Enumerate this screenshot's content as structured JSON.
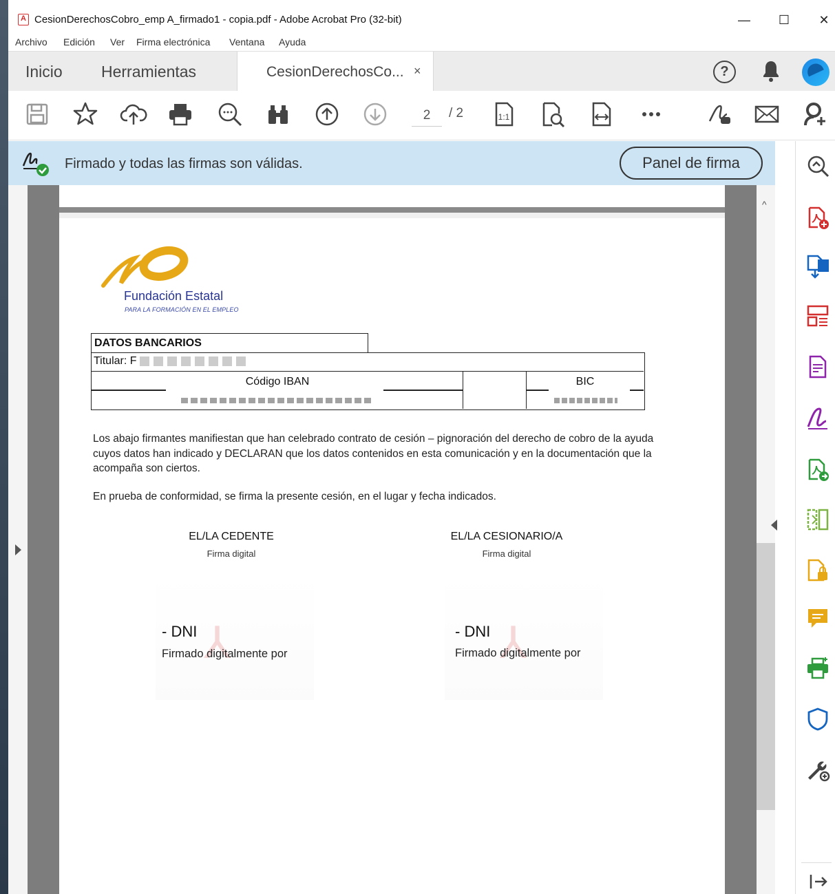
{
  "window": {
    "title": "CesionDerechosCobro_emp A_firmado1 - copia.pdf - Adobe Acrobat Pro (32-bit)",
    "minimize_glyph": "—",
    "maximize_glyph": "☐",
    "close_glyph": "✕"
  },
  "menu": [
    "Archivo",
    "Edición",
    "Ver",
    "Firma electrónica",
    "Ventana",
    "Ayuda"
  ],
  "tabs": {
    "home": "Inicio",
    "tools": "Herramientas",
    "document": "CesionDerechosCo...",
    "close_glyph": "×"
  },
  "toolbar": {
    "page_current": "2",
    "page_total": "/ 2",
    "icons": [
      "save-icon",
      "star-icon",
      "cloud-upload-icon",
      "print-icon",
      "zoom-search-icon",
      "find-binoculars-icon",
      "page-up-icon",
      "page-down-icon",
      "fit-page-icon",
      "document-search-icon",
      "fit-width-icon",
      "more-icon",
      "sign-link-icon",
      "mail-icon",
      "add-user-icon"
    ]
  },
  "signbar": {
    "message": "Firmado y todas las firmas son válidas.",
    "panel_button": "Panel de firma"
  },
  "document": {
    "logo_name": "Fundación Estatal",
    "logo_subtitle": "PARA LA FORMACIÓN EN EL EMPLEO",
    "bank_heading": "DATOS BANCARIOS",
    "titular_label": "Titular: F",
    "iban_label": "Código IBAN",
    "bic_label": "BIC",
    "paragraph1": "Los abajo firmantes manifiestan que han celebrado contrato de cesión – pignoración del derecho de cobro de la ayuda cuyos datos han indicado y DECLARAN que los datos contenidos en esta comunicación y en la documentación que la acompaña son ciertos.",
    "paragraph2": "En prueba de conformidad, se firma la presente cesión, en el lugar y fecha indicados.",
    "cedente_title": "EL/LA CEDENTE",
    "cesionario_title": "EL/LA CESIONARIO/A",
    "digital_signature": "Firma digital",
    "dni_label": "- DNI",
    "signed_by": "Firmado digitalmente por"
  },
  "right_tools": [
    "create-pdf-icon",
    "export-pdf-icon",
    "organize-pages-icon",
    "edit-pdf-icon",
    "fill-sign-icon",
    "combine-files-icon",
    "compare-icon",
    "protect-file-icon",
    "comment-icon",
    "print-production-icon",
    "shield-icon",
    "more-tools-icon"
  ],
  "colors": {
    "signbar_bg": "#cde4f5",
    "logo_gold": "#e6a817",
    "logo_blue": "#283593",
    "acrobat_red": "#d32f2f",
    "tool_green": "#2e9b3c",
    "tool_purple": "#8e24aa",
    "tool_yellow": "#e6a817",
    "tool_blue": "#1565c0"
  }
}
